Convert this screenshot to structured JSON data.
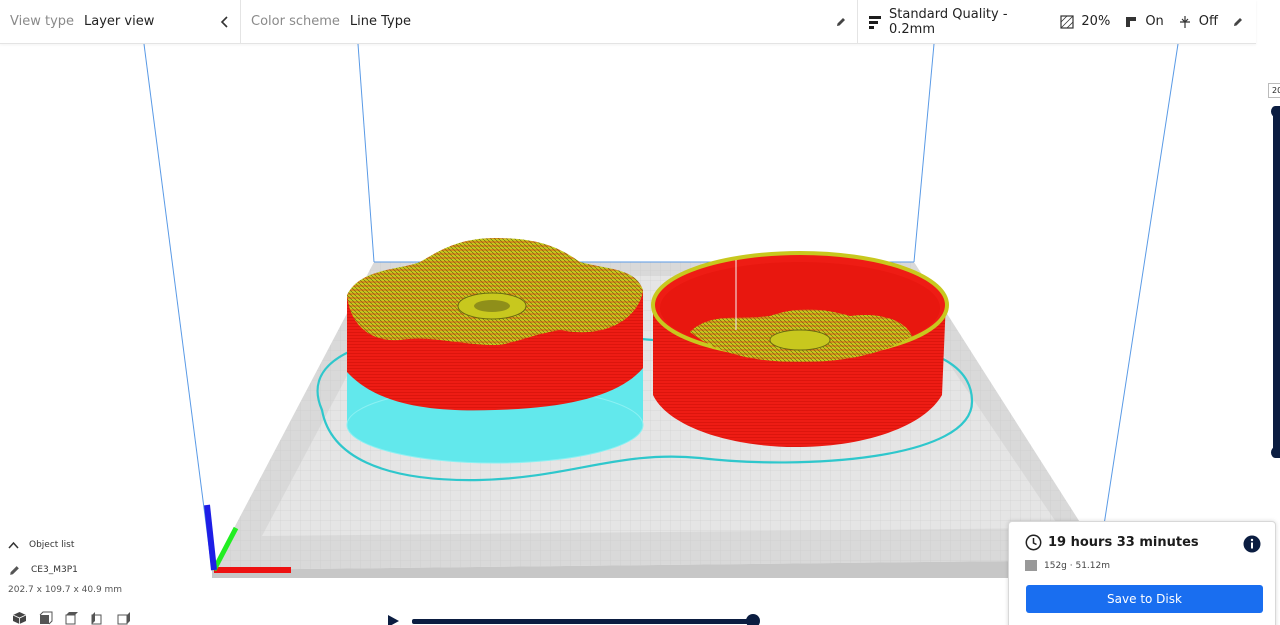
{
  "toolbar": {
    "view_type_label": "View type",
    "view_type_value": "Layer view",
    "color_scheme_label": "Color scheme",
    "color_scheme_value": "Line Type",
    "quality": "Standard Quality - 0.2mm",
    "infill": "20%",
    "support": "On",
    "adhesion": "Off"
  },
  "object_list": {
    "toggle_label": "Object list",
    "object_name": "CE3_M3P1",
    "dimensions": "202.7 x 109.7 x 40.9 mm"
  },
  "layer_slider": {
    "top_layer_label": "20"
  },
  "print_panel": {
    "time": "19 hours 33 minutes",
    "material": "152g · 51.12m",
    "save_label": "Save to Disk"
  },
  "colors": {
    "accent": "#196ef0",
    "slider": "#0b1d41",
    "wall_outer": "#ee1c14",
    "skin": "#c8c81e",
    "support": "#62e8ec",
    "axis_x": "#ee1111",
    "axis_y": "#22ee22",
    "axis_z": "#1e1ee6"
  },
  "icons": {
    "view_collapse": "chevron-left-icon",
    "color_edit": "pencil-icon",
    "quality": "quality-bars-icon",
    "infill": "infill-icon",
    "support": "support-icon",
    "adhesion": "adhesion-icon",
    "settings_edit": "pencil-icon",
    "time": "clock-icon",
    "info": "info-icon",
    "material": "spool-icon",
    "play": "play-icon"
  }
}
